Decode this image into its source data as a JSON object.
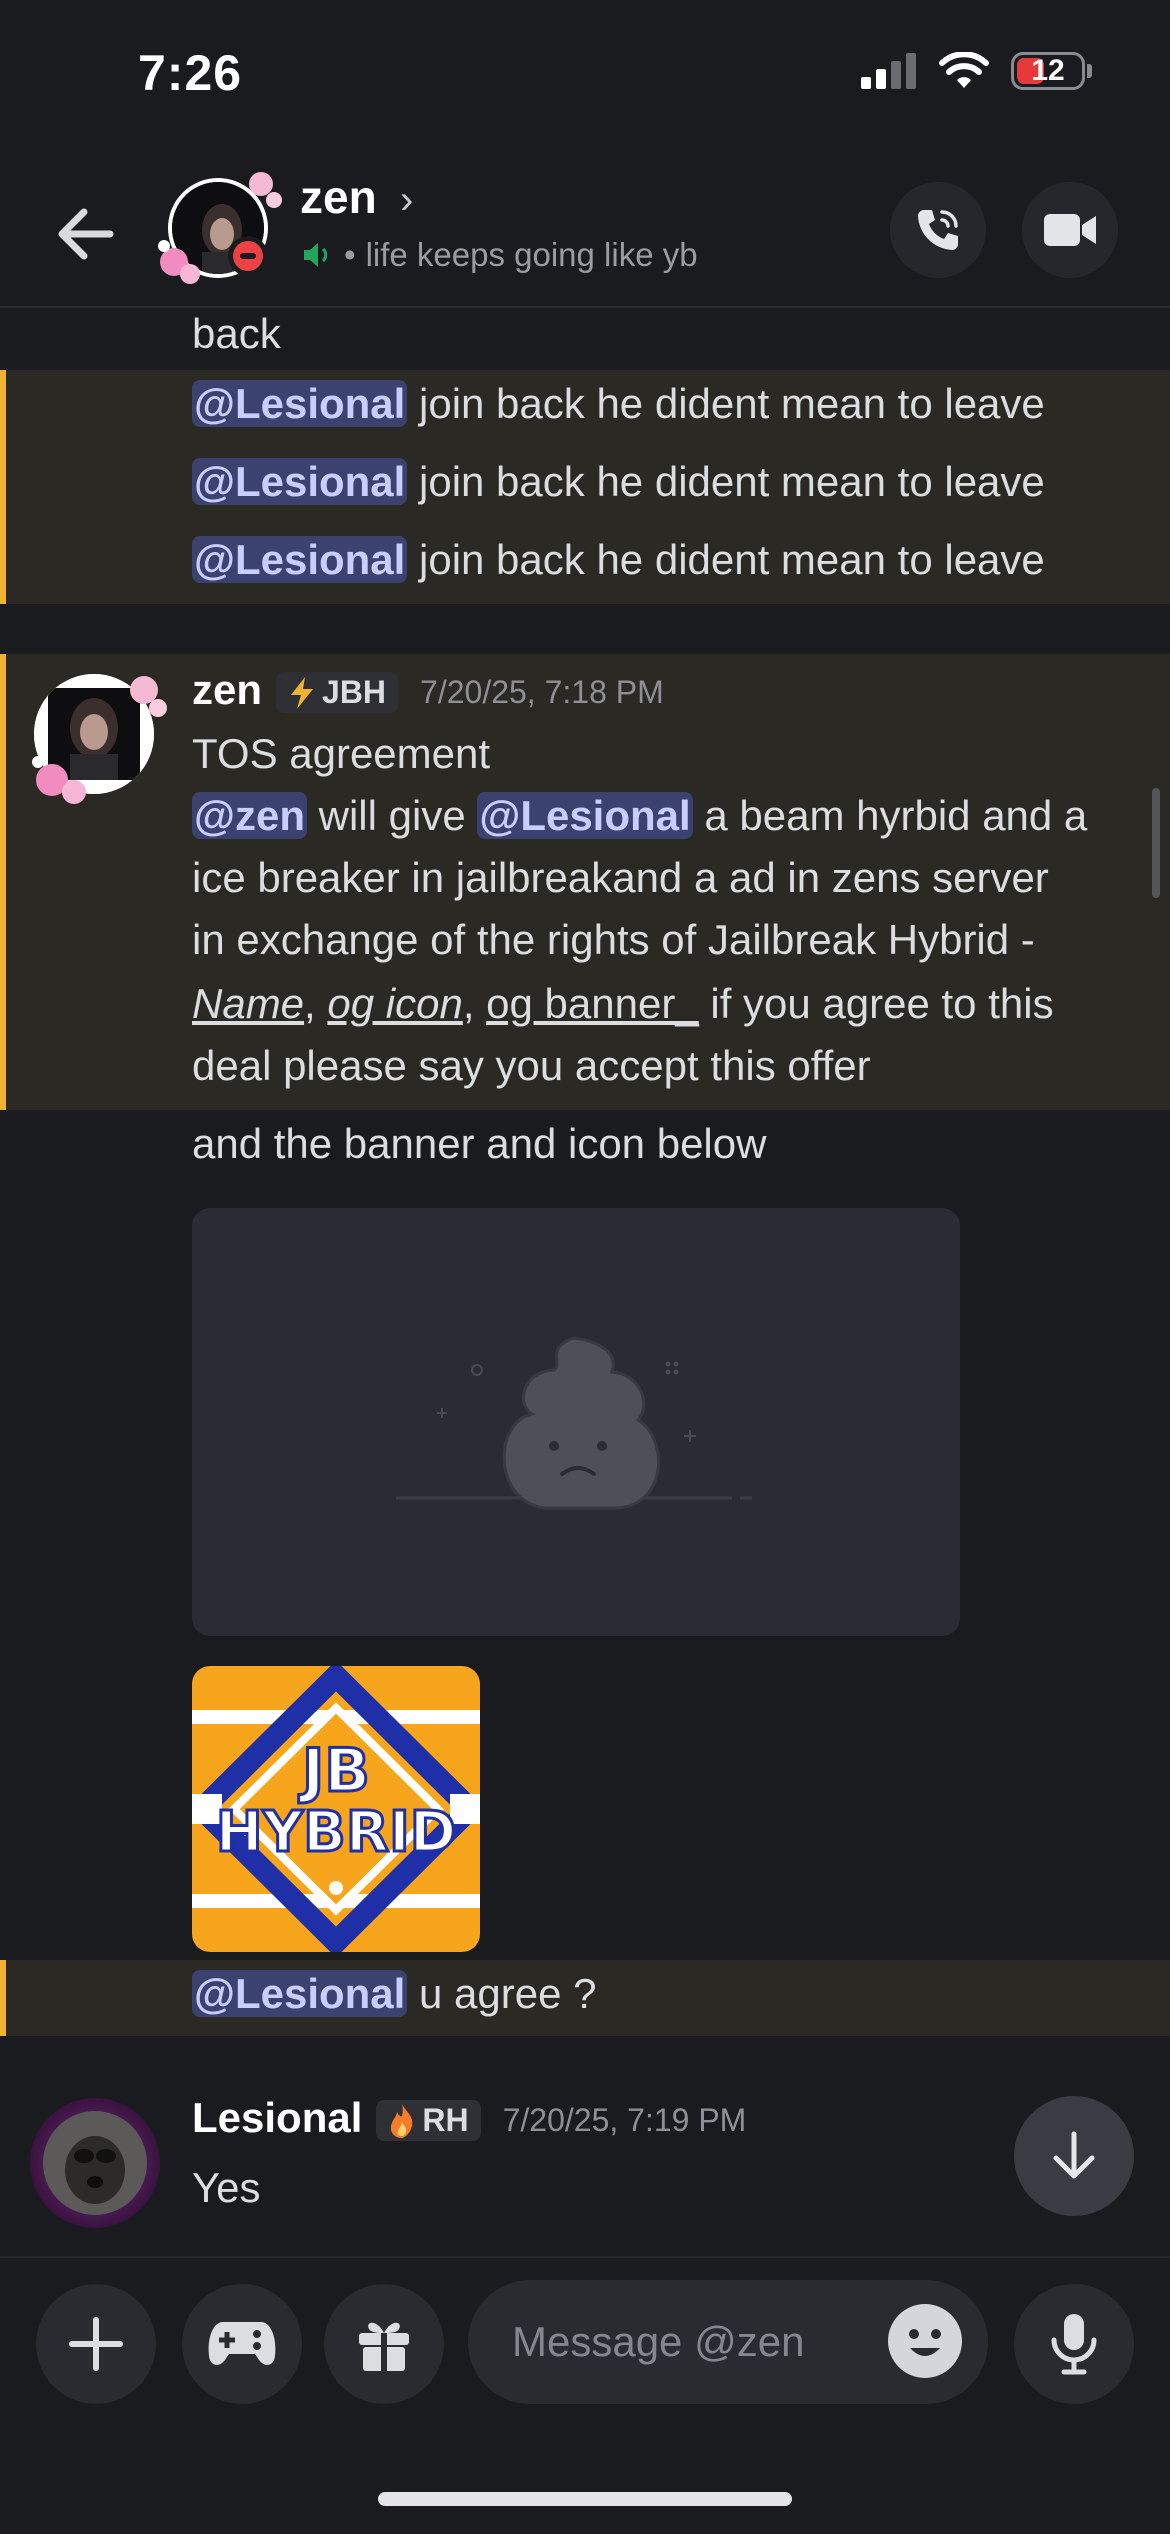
{
  "status_bar": {
    "time": "7:26",
    "battery": "12"
  },
  "header": {
    "name": "zen",
    "chevron": "›",
    "status_separator": "•",
    "status_text": "life keeps going like yb"
  },
  "messages": {
    "line_back": "back",
    "repeat_mention": "@Lesional",
    "repeat_text": " join back he dident mean to leave",
    "zen_msg": {
      "author": "zen",
      "tag": "JBH",
      "timestamp": "7/20/25, 7:18 PM",
      "line1": "TOS agreement",
      "l2_mention1": "@zen",
      "l2_text1": " will give ",
      "l2_mention2": "@Lesional",
      "l2_text2": " a beam hyrbid and a",
      "line3": "ice breaker in jailbreakand a ad in zens server",
      "line4": "in exchange of the rights of Jailbreak Hybrid -",
      "l5_name": "Name",
      "l5_sep1": ", ",
      "l5_icon": "og icon",
      "l5_sep2": ", ",
      "l5_banner": "og banner_",
      "l5_text": " if you agree to this",
      "line6": "deal please say you accept this offer",
      "line7": "and the banner and icon below",
      "image_text_top": "JB",
      "image_text_bottom": "HYBRID",
      "agree_mention": "@Lesional",
      "agree_text": " u agree ?"
    },
    "lesional_msg": {
      "author": "Lesional",
      "tag": "RH",
      "timestamp": "7/20/25, 7:19 PM",
      "text": "Yes"
    }
  },
  "composer": {
    "placeholder": "Message @zen"
  },
  "colors": {
    "background": "#1a1b1f",
    "highlight": "#2b2923",
    "highlight_bar": "#f0b232",
    "mention_bg": "#3c4270",
    "mention_text": "#c9cdfb",
    "dnd": "#ed4245",
    "voice": "#23a55a"
  },
  "icons": [
    "signal-icon",
    "wifi-icon",
    "battery-icon",
    "back-arrow-icon",
    "dnd-status-icon",
    "speaker-icon",
    "phone-call-icon",
    "video-camera-icon",
    "lightning-icon",
    "flame-icon",
    "broken-image-icon",
    "arrow-down-icon",
    "plus-icon",
    "gamepad-icon",
    "gift-icon",
    "emoji-icon",
    "microphone-icon"
  ]
}
